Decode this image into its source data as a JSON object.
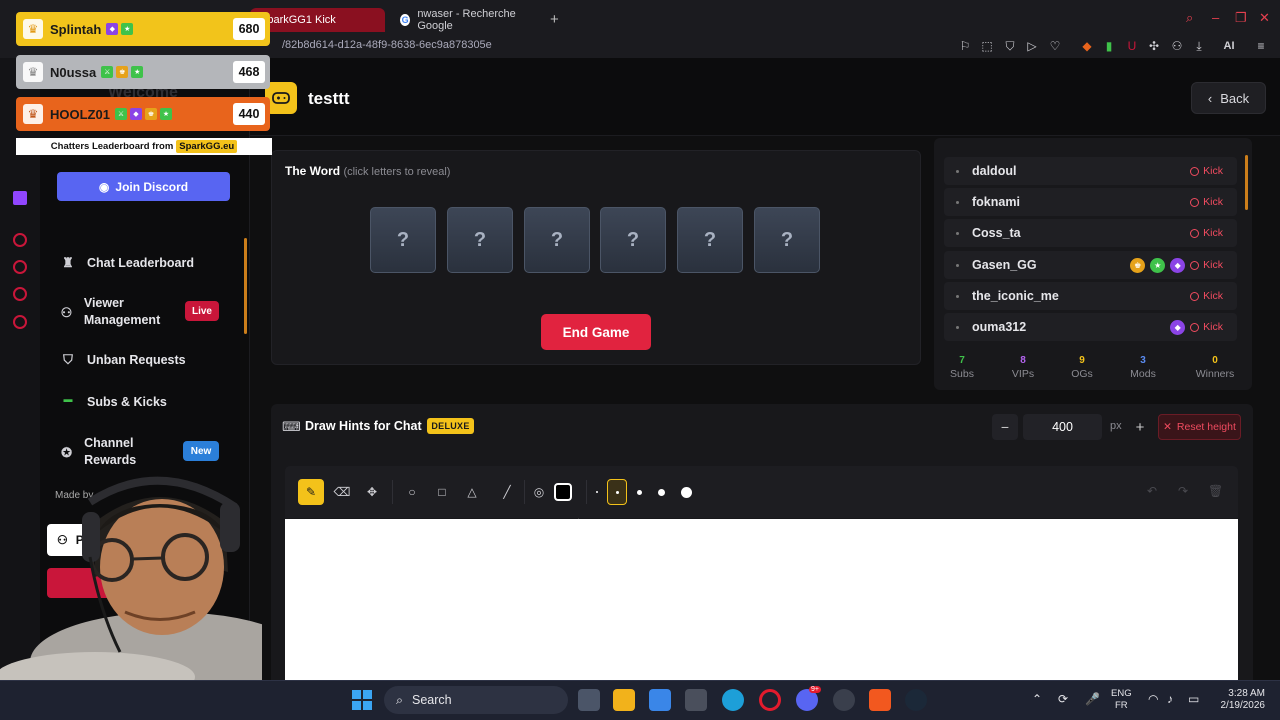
{
  "browser": {
    "active_tab": "SparkGG1 Kick",
    "tab2": "nwaser - Recherche Google",
    "url": "sparkgg.eu/guess-the-word/82b8d614-d12a-48f9-8638-6ec9a878305e",
    "url_visible": "/82b8d614-d12a-48f9-8638-6ec9a878305e",
    "ai_label": "AI"
  },
  "overlay": {
    "leaderboard": [
      {
        "name": "Splintah",
        "points": "680",
        "color": "#f2c41b"
      },
      {
        "name": "N0ussa",
        "points": "468",
        "color": "#b4b6ba"
      },
      {
        "name": "HOOLZ01",
        "points": "440",
        "color": "#e8641c"
      }
    ],
    "footer_text": "Chatters Leaderboard from",
    "footer_site": "SparkGG.eu",
    "hidden_welcome": "Welcome"
  },
  "sidebar": {
    "discord_label": "Join Discord",
    "items": [
      {
        "label": "Chat Leaderboard",
        "icon": "trophy-icon"
      },
      {
        "label": "Viewer Management",
        "icon": "users-icon",
        "badge": "Live"
      },
      {
        "label": "Unban Requests",
        "icon": "shield-icon"
      },
      {
        "label": "Subs & Kicks",
        "icon": "kick-icon"
      },
      {
        "label": "Channel Rewards",
        "icon": "award-icon",
        "badge": "New"
      }
    ],
    "made_by": "Made by",
    "profile_label": "P"
  },
  "header": {
    "title": "testtt",
    "back_label": "Back"
  },
  "word": {
    "title": "The Word",
    "hint": "(click letters to reveal)",
    "letters": [
      "?",
      "?",
      "?",
      "?",
      "?",
      "?"
    ],
    "end_game_label": "End Game"
  },
  "users": {
    "kick_label": "Kick",
    "rows": [
      {
        "name": "daldoul",
        "badges": []
      },
      {
        "name": "foknami",
        "badges": []
      },
      {
        "name": "Coss_ta",
        "badges": []
      },
      {
        "name": "Gasen_GG",
        "badges": [
          "#e6a21a",
          "#3fc24a",
          "#8b44e6"
        ]
      },
      {
        "name": "the_iconic_me",
        "badges": []
      },
      {
        "name": "ouma312",
        "badges": [
          "#8b44e6"
        ]
      }
    ],
    "stats": [
      {
        "num": "7",
        "label": "Subs",
        "color": "#3fc24a"
      },
      {
        "num": "8",
        "label": "VIPs",
        "color": "#b464f0"
      },
      {
        "num": "9",
        "label": "OGs",
        "color": "#f3c21a"
      },
      {
        "num": "3",
        "label": "Mods",
        "color": "#5b8cf2"
      },
      {
        "num": "0",
        "label": "Winners",
        "color": "#f3c21a"
      }
    ]
  },
  "draw": {
    "title": "Draw Hints for Chat",
    "badge": "DELUXE",
    "height_value": "400",
    "unit": "px",
    "reset_label": "Reset height",
    "selected_color": "#000000"
  },
  "taskbar": {
    "search_placeholder": "Search",
    "lang_top": "ENG",
    "lang_bottom": "FR",
    "time": "3:28 AM",
    "date": "2/19/2026",
    "discord_badge": "9+"
  }
}
